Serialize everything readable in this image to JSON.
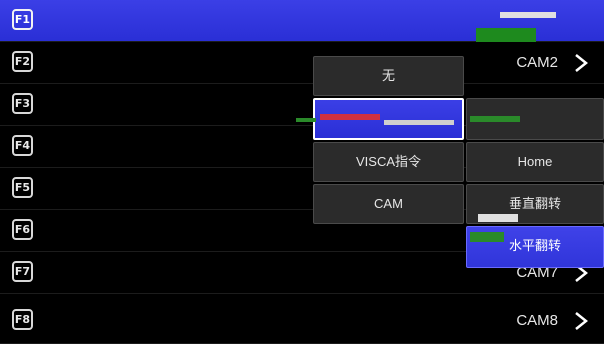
{
  "rows": [
    {
      "key": "F1",
      "value": "",
      "chevron": false,
      "selected": true
    },
    {
      "key": "F2",
      "value": "CAM2",
      "chevron": true,
      "selected": false
    },
    {
      "key": "F3",
      "value": "",
      "chevron": false,
      "selected": false
    },
    {
      "key": "F4",
      "value": "",
      "chevron": false,
      "selected": false
    },
    {
      "key": "F5",
      "value": "",
      "chevron": false,
      "selected": false
    },
    {
      "key": "F6",
      "value": "",
      "chevron": false,
      "selected": false
    },
    {
      "key": "F7",
      "value": "CAM7",
      "chevron": true,
      "selected": false
    },
    {
      "key": "F8",
      "value": "CAM8",
      "chevron": true,
      "selected": false
    }
  ],
  "menu": {
    "left": [
      {
        "label": "无",
        "state": "normal"
      },
      {
        "label": "",
        "state": "selected"
      },
      {
        "label": "VISCA指令",
        "state": "normal"
      },
      {
        "label": "CAM",
        "state": "normal"
      }
    ],
    "right": [
      {
        "label": "",
        "state": "normal"
      },
      {
        "label": "",
        "state": "dim"
      },
      {
        "label": "Home",
        "state": "normal"
      },
      {
        "label": "垂直翻转",
        "state": "normal"
      },
      {
        "label": "水平翻转",
        "state": "highlight"
      }
    ]
  },
  "colors": {
    "accent": "#3b3fe6",
    "background": "#000000",
    "button": "#2b2b2b"
  }
}
